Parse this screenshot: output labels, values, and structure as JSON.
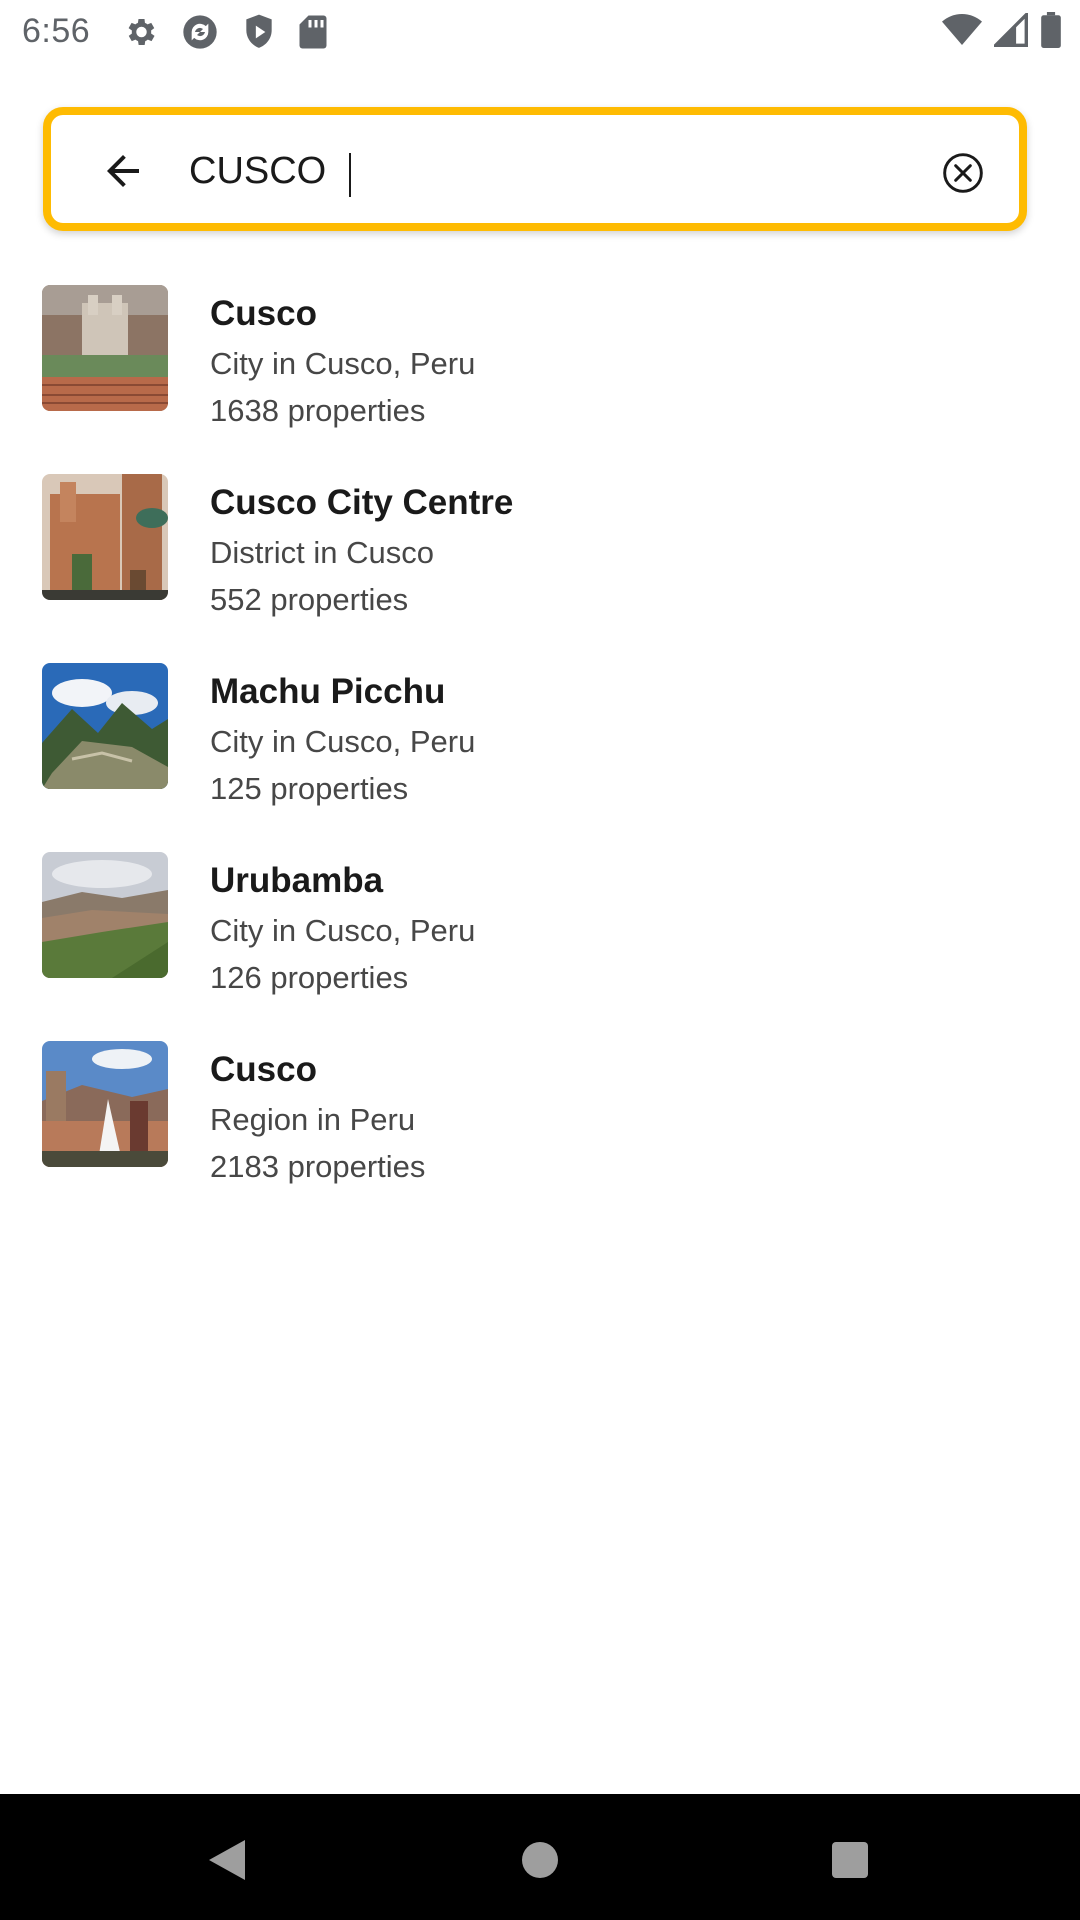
{
  "status_bar": {
    "time": "6:56",
    "left_icons": [
      "settings-icon",
      "sync-icon",
      "shield-play-icon",
      "sd-card-icon"
    ],
    "right_icons": [
      "wifi-icon",
      "signal-icon",
      "battery-icon"
    ]
  },
  "search": {
    "value": "CUSCO",
    "border_color": "#febb02",
    "back_icon": "arrow-back-icon",
    "clear_icon": "clear-circle-icon"
  },
  "results": [
    {
      "title": "Cusco",
      "subtitle": "City in Cusco, Peru",
      "count": "1638 properties"
    },
    {
      "title": "Cusco City Centre",
      "subtitle": "District in Cusco",
      "count": "552 properties"
    },
    {
      "title": "Machu Picchu",
      "subtitle": "City in Cusco, Peru",
      "count": "125 properties"
    },
    {
      "title": "Urubamba",
      "subtitle": "City in Cusco, Peru",
      "count": "126 properties"
    },
    {
      "title": "Cusco",
      "subtitle": "Region in Peru",
      "count": "2183 properties"
    }
  ],
  "nav_bar": {
    "icons": [
      "nav-back-icon",
      "nav-home-icon",
      "nav-recents-icon"
    ]
  }
}
